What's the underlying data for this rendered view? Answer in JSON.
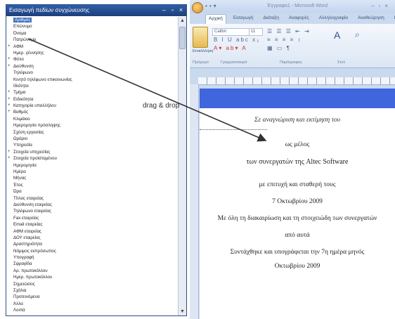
{
  "field_panel": {
    "title": "Εισαγωγή πεδίων συγχώνευσης",
    "items": [
      {
        "label": "Αριθμός",
        "selected": true,
        "expandable": false
      },
      {
        "label": "Επώνυμο",
        "selected": false,
        "expandable": false
      },
      {
        "label": "Όνομα",
        "selected": false,
        "expandable": false
      },
      {
        "label": "Πατρώνυμο",
        "selected": false,
        "expandable": false
      },
      {
        "label": "ΑΦΜ",
        "selected": false,
        "expandable": true
      },
      {
        "label": "Ημερ. γέννησης",
        "selected": false,
        "expandable": false
      },
      {
        "label": "Φύλο",
        "selected": false,
        "expandable": true
      },
      {
        "label": "Διεύθυνση",
        "selected": false,
        "expandable": true
      },
      {
        "label": "Τηλέφωνο",
        "selected": false,
        "expandable": false
      },
      {
        "label": "Κινητό τηλέφωνο επικοινωνίας",
        "selected": false,
        "expandable": false
      },
      {
        "label": "Ιδιότητα",
        "selected": false,
        "expandable": false
      },
      {
        "label": "Τμήμα",
        "selected": false,
        "expandable": true
      },
      {
        "label": "Ειδικότητα",
        "selected": false,
        "expandable": true
      },
      {
        "label": "Κατηγορία υπαλλήλου",
        "selected": false,
        "expandable": true
      },
      {
        "label": "Βαθμός",
        "selected": false,
        "expandable": true
      },
      {
        "label": "Κλιμάκιο",
        "selected": false,
        "expandable": false
      },
      {
        "label": "Ημερομηνία πρόσληψης",
        "selected": false,
        "expandable": false
      },
      {
        "label": "Σχέση εργασίας",
        "selected": false,
        "expandable": false
      },
      {
        "label": "Ωράριο",
        "selected": false,
        "expandable": false
      },
      {
        "label": "Υπηρεσία",
        "selected": false,
        "expandable": false
      },
      {
        "label": "Στοιχεία υπηρεσίας",
        "selected": false,
        "expandable": true
      },
      {
        "label": "Στοιχεία προϊσταμένου",
        "selected": false,
        "expandable": true
      },
      {
        "label": "Ημερομηνία",
        "selected": false,
        "expandable": false
      },
      {
        "label": "Ημέρα",
        "selected": false,
        "expandable": false
      },
      {
        "label": "Μήνας",
        "selected": false,
        "expandable": false
      },
      {
        "label": "Έτος",
        "selected": false,
        "expandable": false
      },
      {
        "label": "Ώρα",
        "selected": false,
        "expandable": false
      },
      {
        "label": "Τίτλος εταιρείας",
        "selected": false,
        "expandable": false
      },
      {
        "label": "Διεύθυνση εταιρείας",
        "selected": false,
        "expandable": false
      },
      {
        "label": "Τηλέφωνο εταιρείας",
        "selected": false,
        "expandable": false
      },
      {
        "label": "Fax εταιρείας",
        "selected": false,
        "expandable": false
      },
      {
        "label": "Email εταιρείας",
        "selected": false,
        "expandable": false
      },
      {
        "label": "ΑΦΜ εταιρείας",
        "selected": false,
        "expandable": false
      },
      {
        "label": "ΔΟΥ εταιρείας",
        "selected": false,
        "expandable": false
      },
      {
        "label": "Δραστηριότητα",
        "selected": false,
        "expandable": false
      },
      {
        "label": "Νόμιμος εκπρόσωπος",
        "selected": false,
        "expandable": false
      },
      {
        "label": "Υπογραφή",
        "selected": false,
        "expandable": false
      },
      {
        "label": "Σφραγίδα",
        "selected": false,
        "expandable": false
      },
      {
        "label": "Αρ. πρωτοκόλλου",
        "selected": false,
        "expandable": false
      },
      {
        "label": "Ημερ. πρωτοκόλλου",
        "selected": false,
        "expandable": false
      },
      {
        "label": "Σημειώσεις",
        "selected": false,
        "expandable": false
      },
      {
        "label": "Σχόλια",
        "selected": false,
        "expandable": false
      },
      {
        "label": "Προτεινόμενα",
        "selected": false,
        "expandable": false
      },
      {
        "label": "Άλλα",
        "selected": false,
        "expandable": false
      },
      {
        "label": "Λοιπά",
        "selected": false,
        "expandable": false
      }
    ]
  },
  "drag_hint": "drag & drop",
  "word": {
    "title": "Έγγραφο1 - Microsoft Word",
    "tabs": [
      "Αρχική",
      "Εισαγωγή",
      "Διάταξη",
      "Αναφορές",
      "Αλληλογραφία",
      "Αναθεώρηση",
      "Προβολή"
    ],
    "active_tab": "Αρχική",
    "paste_label": "Επικόλληση",
    "font_name": "Calibri",
    "font_size": "11",
    "groups": [
      "Πρόχειρο",
      "Γραμματοσειρά",
      "Παράγραφος",
      "Στυλ"
    ],
    "document_lines": {
      "line1": "Σε αναγνώριση και εκτίμηση του",
      "line3": "ως μέλος",
      "line4": "των συνεργατών της Altec Software",
      "line5": "με επιτυχή και σταθερή τους",
      "line6": "7 Οκτωβρίου 2009",
      "line7": "Με όλη τη διακαιρίωση και τη στοιχειώδη των συνεργατών",
      "line8": "από αυτά",
      "line9": "Συντάχθηκε και υπογράφεται την 7η ημέρα μηνός",
      "line10": "Οκτωβρίου 2009"
    }
  },
  "colors": {
    "panel_title": "#1d3f7c",
    "selection": "#3f6fc0",
    "header_band": "#3f66dc",
    "word_frame": "#c9d9ee"
  }
}
